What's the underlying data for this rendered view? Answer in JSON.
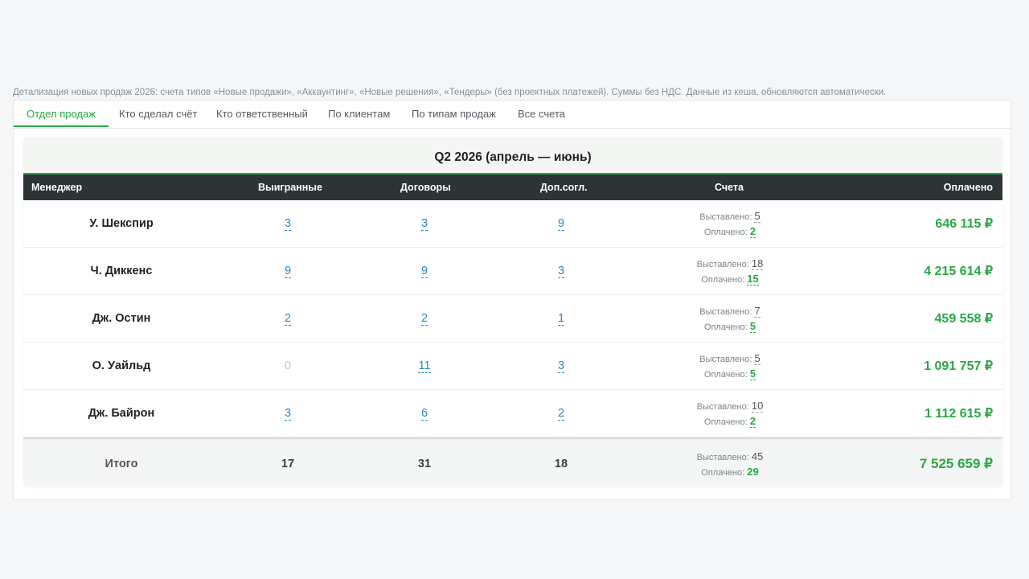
{
  "description": "Детализация новых продаж 2026: счета типов «Новые продажи», «Аккаунтинг», «Новые решения», «Тендеры» (без проектных платежей). Суммы без НДС. Данные из кеша, обновляются автоматически.",
  "tabs": [
    {
      "label": "Отдел продаж",
      "active": true
    },
    {
      "label": "Кто сделал счёт",
      "active": false
    },
    {
      "label": "Кто ответственный",
      "active": false
    },
    {
      "label": "По клиентам",
      "active": false
    },
    {
      "label": "По типам продаж",
      "active": false
    },
    {
      "label": "Все счета",
      "active": false
    }
  ],
  "period_title": "Q2 2026 (апрель — июнь)",
  "columns": {
    "manager": "Менеджер",
    "won": "Выигранные",
    "contracts": "Договоры",
    "addendums": "Доп.согл.",
    "invoices": "Счета",
    "paid": "Оплачено"
  },
  "labels": {
    "issued": "Выставлено:",
    "paid": "Оплачено:"
  },
  "rows": [
    {
      "name": "У. Шекспир",
      "won": "3",
      "contracts": "3",
      "addendums": "9",
      "issued": "5",
      "paid_count": "2",
      "paid_sum": "646 115 ₽"
    },
    {
      "name": "Ч. Диккенс",
      "won": "9",
      "contracts": "9",
      "addendums": "3",
      "issued": "18",
      "paid_count": "15",
      "paid_sum": "4 215 614 ₽"
    },
    {
      "name": "Дж. Остин",
      "won": "2",
      "contracts": "2",
      "addendums": "1",
      "issued": "7",
      "paid_count": "5",
      "paid_sum": "459 558 ₽"
    },
    {
      "name": "О. Уайльд",
      "won": "0",
      "contracts": "11",
      "addendums": "3",
      "issued": "5",
      "paid_count": "5",
      "paid_sum": "1 091 757 ₽"
    },
    {
      "name": "Дж. Байрон",
      "won": "3",
      "contracts": "6",
      "addendums": "2",
      "issued": "10",
      "paid_count": "2",
      "paid_sum": "1 112 615 ₽"
    }
  ],
  "total": {
    "name": "Итого",
    "won": "17",
    "contracts": "31",
    "addendums": "18",
    "issued": "45",
    "paid_count": "29",
    "paid_sum": "7 525 659 ₽"
  },
  "colors": {
    "accent_green": "#28a745",
    "link_blue": "#2e86c1",
    "header_dark": "#2d3436"
  }
}
